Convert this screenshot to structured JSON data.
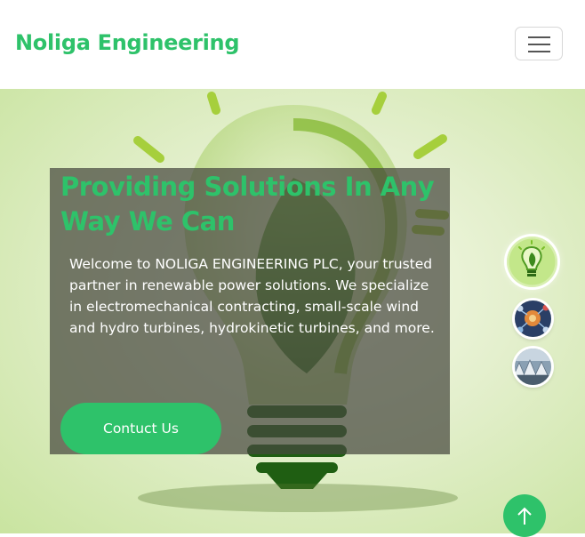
{
  "navbar": {
    "brand": "Noliga Engineering",
    "menu_icon": "hamburger-menu-icon"
  },
  "hero": {
    "headline": "Providing Solutions In Any Way We Can",
    "intro": "Welcome to NOLIGA ENGINEERING PLC, your trusted partner in renewable power solutions. We specialize in electromechanical contracting, small-scale wind and hydro turbines, hydrokinetic turbines, and more.",
    "cta_label": "Contuct Us",
    "background_image": "green-lightbulb-with-leaf"
  },
  "carousel": {
    "thumbnails": [
      {
        "image": "green-lightbulb-thumbnail",
        "active": true
      },
      {
        "image": "gears-network-thumbnail",
        "active": false
      },
      {
        "image": "turbines-thumbnail",
        "active": false
      }
    ]
  },
  "back_to_top": {
    "icon": "arrow-up-icon"
  },
  "colors": {
    "accent": "#2ec26a",
    "overlay": "#46483e",
    "text_light": "#ffffff"
  }
}
